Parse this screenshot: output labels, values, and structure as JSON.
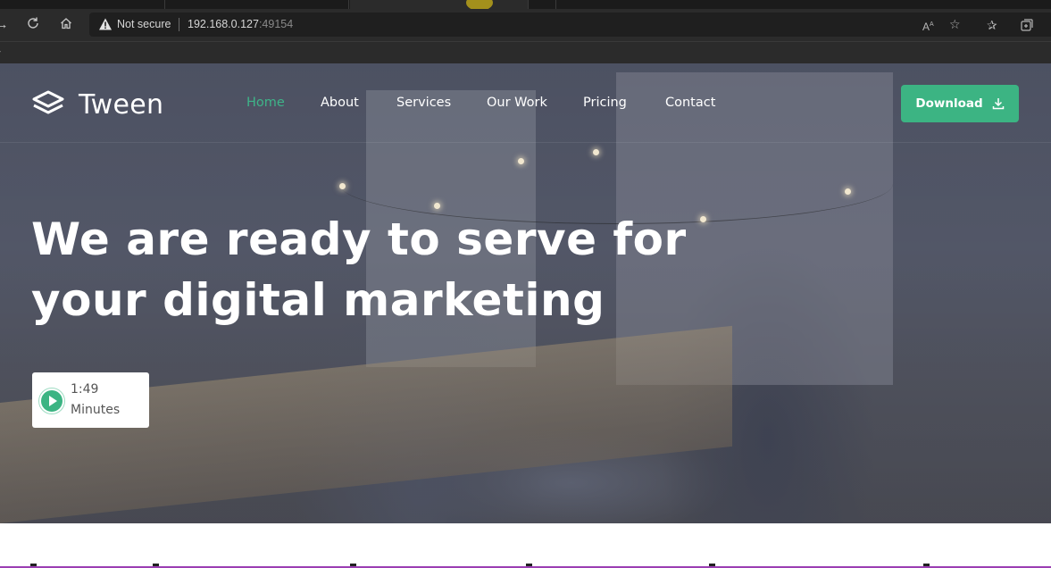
{
  "browser": {
    "address": {
      "security_label": "Not secure",
      "host": "192.168.0.127",
      "port": ":49154"
    },
    "icons": [
      "back-icon",
      "refresh-icon",
      "home-icon",
      "read-aloud-icon",
      "favorite-add-icon",
      "favorites-icon",
      "collections-icon"
    ]
  },
  "site": {
    "brand": "Tween",
    "nav": [
      {
        "label": "Home",
        "active": true
      },
      {
        "label": "About",
        "active": false
      },
      {
        "label": "Services",
        "active": false
      },
      {
        "label": "Our Work",
        "active": false
      },
      {
        "label": "Pricing",
        "active": false
      },
      {
        "label": "Contact",
        "active": false
      }
    ],
    "download_label": "Download",
    "headline_line1": "We are ready to serve for",
    "headline_line2": "your digital marketing",
    "video": {
      "duration": "1:49",
      "unit": "Minutes"
    },
    "colors": {
      "accent": "#3cb483",
      "overlay": "#343a4e"
    }
  }
}
